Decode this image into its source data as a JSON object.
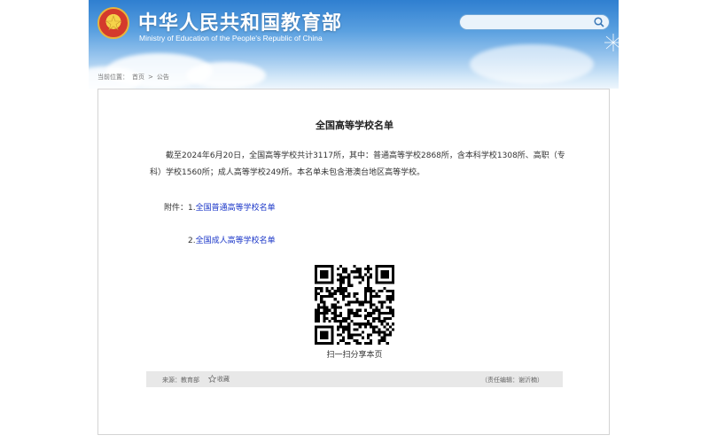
{
  "header": {
    "title_cn": "中华人民共和国教育部",
    "title_en": "Ministry of Education of the People's Republic of China",
    "search": {
      "placeholder": "",
      "value": ""
    }
  },
  "breadcrumb": {
    "prefix": "当前位置：",
    "items": [
      "首页",
      ">",
      "公告"
    ]
  },
  "article": {
    "title": "全国高等学校名单",
    "body": "截至2024年6月20日，全国高等学校共计3117所，其中：普通高等学校2868所，含本科学校1308所、高职（专科）学校1560所；成人高等学校249所。本名单未包含港澳台地区高等学校。",
    "attachments_label": "附件：",
    "attachments": [
      {
        "index": "1.",
        "label": "全国普通高等学校名单"
      },
      {
        "index": "2.",
        "label": "全国成人高等学校名单"
      }
    ],
    "qr_caption": "扫一扫分享本页"
  },
  "info_bar": {
    "source": "来源：教育部",
    "favorite": "收藏",
    "editor": "（责任编辑：谢沂楠）"
  },
  "colors": {
    "header_top": "#2f7fd0",
    "link": "#1a36c8",
    "info_bar_bg": "#e8e8e8"
  }
}
